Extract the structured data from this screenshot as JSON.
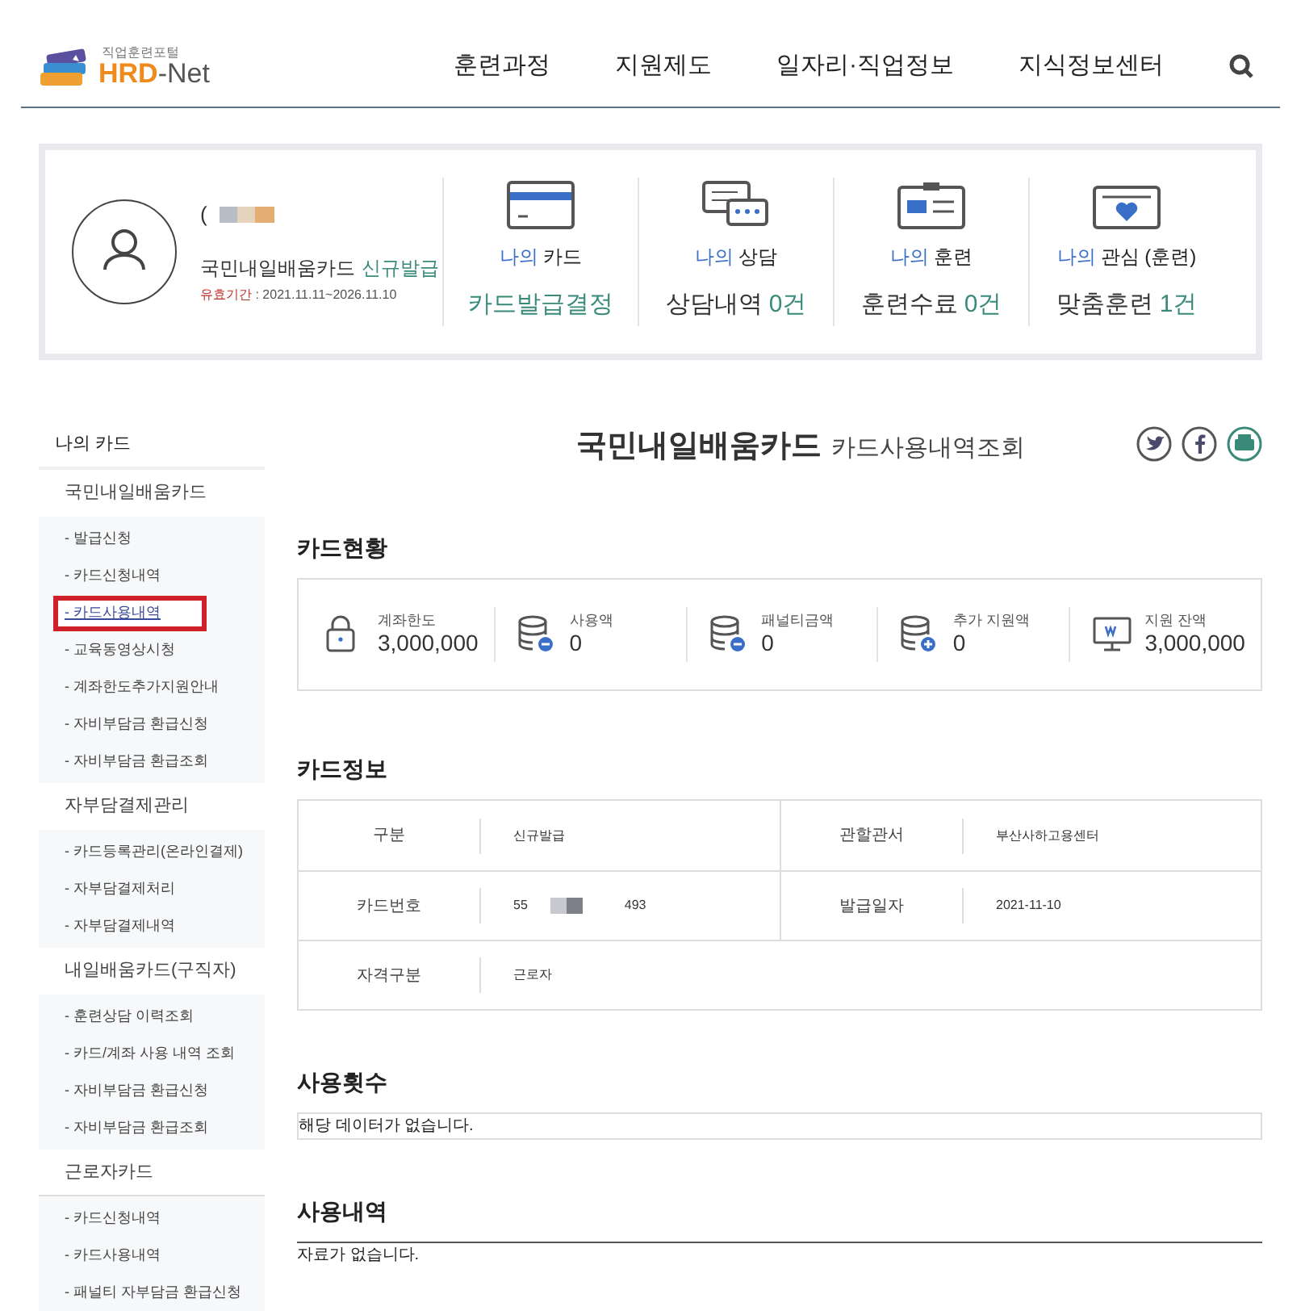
{
  "header": {
    "logo_tagline": "직업훈련포털",
    "logo_name_a": "HRD",
    "logo_name_b": "-Net",
    "nav": [
      "훈련과정",
      "지원제도",
      "일자리·직업정보",
      "지식정보센터"
    ]
  },
  "profile": {
    "name": "(",
    "card_name": "국민내일배움카드",
    "card_status": "신규발급",
    "validity_label": "유효기간",
    "validity": " : 2021.11.11~2026.11.10",
    "summary": [
      {
        "kind": "card",
        "prefix": "나의",
        "label": "카드",
        "value": "카드발급결정"
      },
      {
        "kind": "chat",
        "prefix": "나의",
        "label": "상담",
        "value": "상담내역",
        "count": "0건"
      },
      {
        "kind": "id",
        "prefix": "나의",
        "label": "훈련",
        "value": "훈련수료",
        "count": "0건"
      },
      {
        "kind": "heart",
        "prefix": "나의",
        "label": "관심 (훈련)",
        "value": "맞춤훈련",
        "count": "1건"
      }
    ]
  },
  "sidebar": {
    "title": "나의 카드",
    "groups": [
      {
        "title": "국민내일배움카드",
        "items": [
          {
            "label": "- 발급신청",
            "selected": false
          },
          {
            "label": "- 카드신청내역",
            "selected": false
          },
          {
            "label": "- 카드사용내역",
            "selected": true
          },
          {
            "label": "- 교육동영상시청",
            "selected": false
          },
          {
            "label": "- 계좌한도추가지원안내",
            "selected": false
          },
          {
            "label": "- 자비부담금 환급신청",
            "selected": false
          },
          {
            "label": "- 자비부담금 환급조회",
            "selected": false
          }
        ]
      },
      {
        "title": "자부담결제관리",
        "items": [
          {
            "label": "- 카드등록관리(온라인결제)",
            "selected": false
          },
          {
            "label": "- 자부담결제처리",
            "selected": false
          },
          {
            "label": "- 자부담결제내역",
            "selected": false
          }
        ]
      },
      {
        "title": "내일배움카드(구직자)",
        "items": [
          {
            "label": "- 훈련상담 이력조회",
            "selected": false
          },
          {
            "label": "- 카드/계좌 사용 내역 조회",
            "selected": false
          },
          {
            "label": "- 자비부담금 환급신청",
            "selected": false
          },
          {
            "label": "- 자비부담금 환급조회",
            "selected": false
          }
        ]
      },
      {
        "title": "근로자카드",
        "items": [
          {
            "label": "- 카드신청내역",
            "selected": false
          },
          {
            "label": "- 카드사용내역",
            "selected": false
          },
          {
            "label": "- 패널티 자부담금 환급신청",
            "selected": false
          }
        ]
      }
    ]
  },
  "page_title": {
    "main": "국민내일배움카드",
    "sub": "카드사용내역조회"
  },
  "card_status": {
    "title": "카드현황",
    "stats": [
      {
        "kind": "lock",
        "label": "계좌한도",
        "value": "3,000,000"
      },
      {
        "kind": "db-minus",
        "label": "사용액",
        "value": "0"
      },
      {
        "kind": "db-minus",
        "label": "패널티금액",
        "value": "0"
      },
      {
        "kind": "db-plus",
        "label": "추가 지원액",
        "value": "0"
      },
      {
        "kind": "monitor",
        "label": "지원 잔액",
        "value": "3,000,000"
      }
    ]
  },
  "card_info": {
    "title": "카드정보",
    "rows": [
      [
        {
          "label": "구분",
          "value": "신규발급"
        },
        {
          "label": "관할관서",
          "value": "부산사하고용센터"
        }
      ],
      [
        {
          "label": "카드번호",
          "value": "55",
          "value_end": "493"
        },
        {
          "label": "발급일자",
          "value": "2021-11-10"
        }
      ],
      [
        {
          "label": "자격구분",
          "value": "근로자"
        }
      ]
    ]
  },
  "usage_count": {
    "title": "사용횟수",
    "message": "해당 데이터가 없습니다."
  },
  "usage_history": {
    "title": "사용내역",
    "message": "자료가 없습니다."
  }
}
